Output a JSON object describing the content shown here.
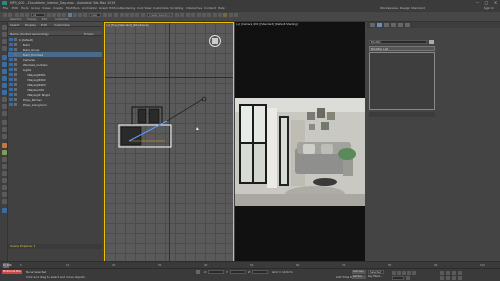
{
  "window": {
    "title": "MP3_000 - Zhoubfarm_Interior_Day.max - Autodesk 3ds Max 2019",
    "min": "─",
    "max": "□",
    "close": "✕"
  },
  "menubar": {
    "items": [
      "File",
      "Edit",
      "Tools",
      "Group",
      "Views",
      "Create",
      "Modifiers",
      "Animation",
      "Graph Editors",
      "Rendering",
      "Civil View",
      "Customize",
      "Scripting",
      "Interactive",
      "Content",
      "Help"
    ],
    "workspace": "Workspaces: Design Standard",
    "signin": "Sign In"
  },
  "toolbar": {
    "view_dropdown": "View",
    "selection_set": "Create Selection Set",
    "ribbon_labels": [
      "Selection",
      "Display",
      "Edit",
      "Customize"
    ]
  },
  "scene_explorer": {
    "tabs": [
      "Select",
      "Display",
      "Edit",
      "Customize"
    ],
    "col_name": "Name (Sorted Ascending)",
    "col_frozen": "Frozen",
    "rows": [
      {
        "label": "0 (default)",
        "indent": 0,
        "selected": false
      },
      {
        "label": "Build",
        "indent": 1,
        "selected": false
      },
      {
        "label": "Build_Group",
        "indent": 1,
        "selected": false
      },
      {
        "label": "Build_Furniture",
        "indent": 1,
        "selected": true
      },
      {
        "label": "Cameras",
        "indent": 1,
        "selected": false
      },
      {
        "label": "Windows_Curtains",
        "indent": 1,
        "selected": false
      },
      {
        "label": "Lights",
        "indent": 1,
        "selected": false
      },
      {
        "label": "VRayLight001",
        "indent": 2,
        "selected": false
      },
      {
        "label": "VRayLight002",
        "indent": 2,
        "selected": false
      },
      {
        "label": "VRayLight003",
        "indent": 2,
        "selected": false
      },
      {
        "label": "VRaySun001",
        "indent": 2,
        "selected": false
      },
      {
        "label": "VRayLight Target",
        "indent": 2,
        "selected": false
      },
      {
        "label": "Props_Kitchen",
        "indent": 1,
        "selected": false
      },
      {
        "label": "Props_Livingroom",
        "indent": 1,
        "selected": false
      }
    ],
    "footer": "Scene Explorer 1"
  },
  "viewport_top": {
    "label": "[+] [Top] [Standard] [Wireframe]"
  },
  "viewport_cam": {
    "label": "[+] [Camera_001] [Standard] [Default Shading]"
  },
  "command_panel": {
    "name_field": "Box002",
    "modifier_list": "Modifier List"
  },
  "timeline": {
    "ticks": [
      "0",
      "10",
      "20",
      "30",
      "40",
      "50",
      "60",
      "70",
      "80",
      "90",
      "100"
    ],
    "frame_counter": "0 / 100"
  },
  "status": {
    "selection": "None Selected",
    "prompt": "Click and drag to select and move objects",
    "maxscript": "MAXScript Mini",
    "x_label": "X:",
    "y_label": "Y:",
    "z_label": "Z:",
    "grid": "Grid = 10.0cm",
    "autokey": "Auto Key",
    "setkey": "Set Key",
    "selected_dd": "Selected",
    "keyfilters": "Key Filters...",
    "add_time_tag": "Add Time Tag"
  }
}
